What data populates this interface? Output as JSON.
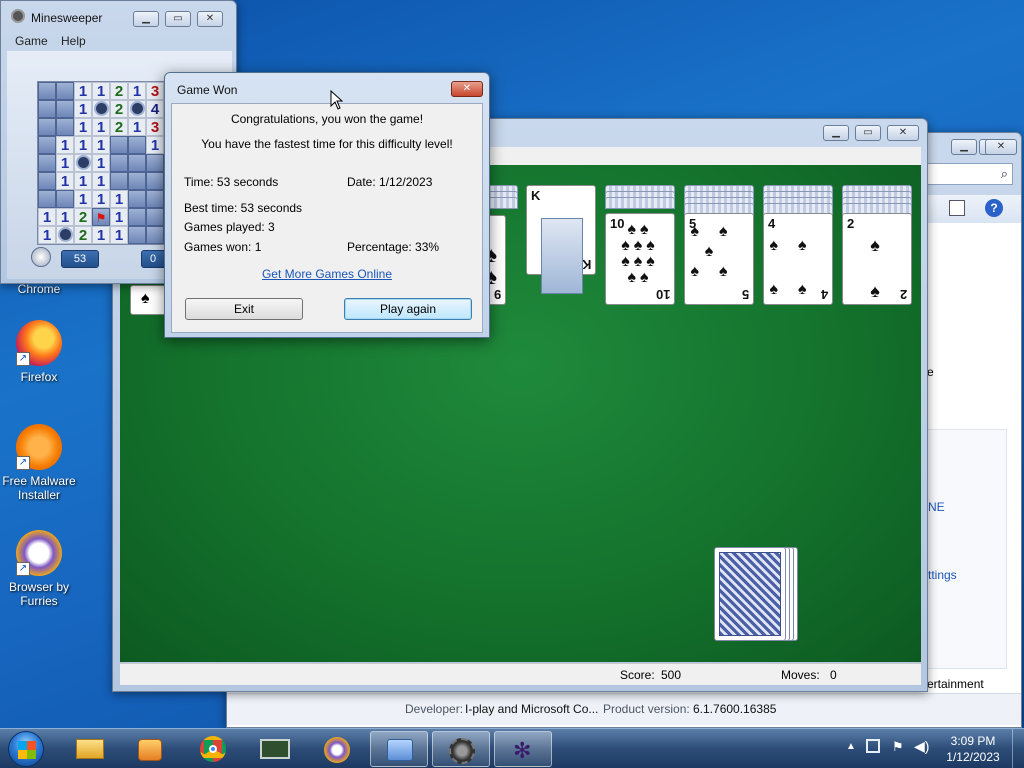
{
  "desktop": {
    "icons": [
      {
        "label": "Chrome"
      },
      {
        "label": "Firefox"
      },
      {
        "label": "Free Malware Installer"
      },
      {
        "label": "Browser by Furries"
      }
    ]
  },
  "minesweeper": {
    "title": "Minesweeper",
    "menu": [
      "Game",
      "Help"
    ],
    "timer": "53",
    "mines_left": "0",
    "grid": [
      [
        "",
        "",
        "1",
        "1",
        "2",
        "1",
        "3"
      ],
      [
        "",
        "",
        "1",
        "*",
        "2",
        "*",
        "4"
      ],
      [
        "",
        "",
        "1",
        "1",
        "2",
        "1",
        "3"
      ],
      [
        "",
        "1",
        "1",
        "1",
        "",
        "",
        "1"
      ],
      [
        "",
        "1",
        "*",
        "1",
        "",
        "",
        ""
      ],
      [
        "",
        "1",
        "1",
        "1",
        "",
        "",
        ""
      ],
      [
        "",
        "",
        "1",
        "1",
        "1",
        "",
        ""
      ],
      [
        "1",
        "1",
        "2",
        "F",
        "1",
        "",
        ""
      ],
      [
        "1",
        "*",
        "2",
        "1",
        "1",
        "",
        ""
      ]
    ]
  },
  "solitaire": {
    "status": {
      "score_label": "Score:",
      "score": "500",
      "moves_label": "Moves:",
      "moves": "0"
    },
    "piles": [
      {
        "rank": "9",
        "backs": 3
      },
      {
        "rank": "K",
        "backs": 0
      },
      {
        "rank": "10",
        "backs": 3
      },
      {
        "rank": "5",
        "backs": 4
      },
      {
        "rank": "4",
        "backs": 4
      },
      {
        "rank": "2",
        "backs": 4
      }
    ]
  },
  "games_explorer": {
    "developer_label": "Developer:",
    "developer": "I-play and Microsoft Co...",
    "version_label": "Product version:",
    "version": "6.1.7600.16385",
    "side_texts": [
      "e",
      "NE",
      "ttings",
      "ertainment"
    ]
  },
  "dialog": {
    "title": "Game Won",
    "line1": "Congratulations, you won the game!",
    "line2": "You have the fastest time for this difficulty level!",
    "time": "Time: 53 seconds",
    "date": "Date: 1/12/2023",
    "best_time": "Best time: 53 seconds",
    "games_played": "Games played: 3",
    "games_won": "Games won: 1",
    "percentage": "Percentage: 33%",
    "link": "Get More Games Online",
    "exit_label": "Exit",
    "play_again_label": "Play again"
  },
  "taskbar": {
    "time": "3:09 PM",
    "date": "1/12/2023"
  },
  "colors": {
    "felt": "#13702b",
    "link": "#1a56b8",
    "ms_one": "#2233aa",
    "ms_two": "#1d6b1d",
    "ms_three": "#b01212",
    "ms_four": "#1a237e"
  }
}
